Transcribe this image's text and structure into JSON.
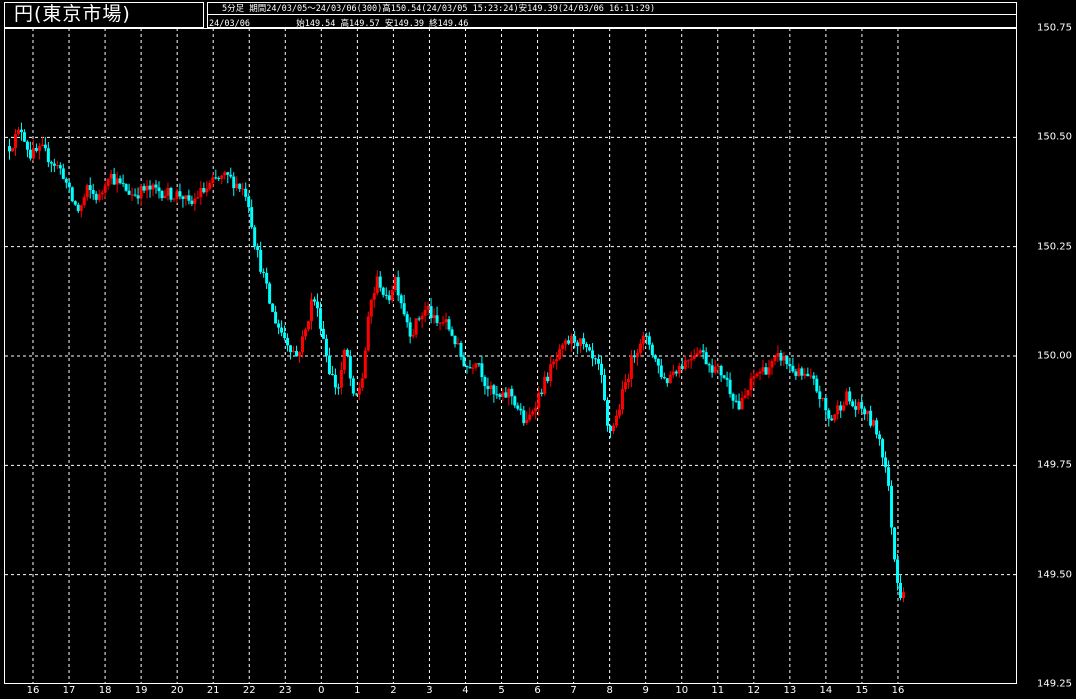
{
  "header": {
    "title": "円(東京市場)",
    "interval_label": "5分足",
    "range_text": "期間24/03/05～24/03/06(300)高150.54(24/03/05 15:23:24)安149.39(24/03/06 16:11:29)",
    "date_label": "24/03/06",
    "ohlc_text": "始149.54 高149.57 安149.39 終149.46"
  },
  "colors": {
    "up": "#ff0000",
    "down": "#00ffff",
    "grid": "#ffffff",
    "background": "#000000"
  },
  "chart_data": {
    "type": "candlestick",
    "title": "円(東京市場)",
    "ylim": [
      149.25,
      150.75
    ],
    "yticks": [
      "149.25",
      "149.50",
      "149.75",
      "150.00",
      "150.25",
      "150.50",
      "150.75"
    ],
    "xticks": [
      "16",
      "17",
      "18",
      "19",
      "20",
      "21",
      "22",
      "23",
      "0",
      "1",
      "2",
      "3",
      "4",
      "5",
      "6",
      "7",
      "8",
      "9",
      "10",
      "11",
      "12",
      "13",
      "14",
      "15",
      "16"
    ],
    "grid": true,
    "price_path": [
      [
        0,
        150.48
      ],
      [
        3,
        150.52
      ],
      [
        5,
        150.46
      ],
      [
        8,
        150.47
      ],
      [
        11,
        150.44
      ],
      [
        13,
        150.42
      ],
      [
        15,
        150.36
      ],
      [
        17,
        150.33
      ],
      [
        19,
        150.38
      ],
      [
        22,
        150.36
      ],
      [
        24,
        150.42
      ],
      [
        27,
        150.39
      ],
      [
        30,
        150.37
      ],
      [
        33,
        150.38
      ],
      [
        36,
        150.38
      ],
      [
        39,
        150.37
      ],
      [
        42,
        150.37
      ],
      [
        44,
        150.34
      ],
      [
        46,
        150.37
      ],
      [
        48,
        150.38
      ],
      [
        50,
        150.4
      ],
      [
        53,
        150.41
      ],
      [
        56,
        150.39
      ],
      [
        58,
        150.37
      ],
      [
        60,
        150.25
      ],
      [
        62,
        150.18
      ],
      [
        64,
        150.1
      ],
      [
        66,
        150.06
      ],
      [
        68,
        150.03
      ],
      [
        70,
        150.0
      ],
      [
        72,
        150.05
      ],
      [
        74,
        150.14
      ],
      [
        76,
        150.07
      ],
      [
        78,
        149.97
      ],
      [
        80,
        149.92
      ],
      [
        82,
        150.02
      ],
      [
        84,
        149.89
      ],
      [
        86,
        149.95
      ],
      [
        88,
        150.12
      ],
      [
        90,
        150.18
      ],
      [
        92,
        150.12
      ],
      [
        94,
        150.18
      ],
      [
        96,
        150.11
      ],
      [
        98,
        150.05
      ],
      [
        100,
        150.09
      ],
      [
        102,
        150.11
      ],
      [
        104,
        150.07
      ],
      [
        106,
        150.08
      ],
      [
        108,
        150.05
      ],
      [
        110,
        150.0
      ],
      [
        112,
        149.97
      ],
      [
        114,
        150.0
      ],
      [
        116,
        149.94
      ],
      [
        118,
        149.91
      ],
      [
        120,
        149.9
      ],
      [
        122,
        149.92
      ],
      [
        124,
        149.88
      ],
      [
        126,
        149.84
      ],
      [
        128,
        149.89
      ],
      [
        130,
        149.93
      ],
      [
        132,
        149.97
      ],
      [
        134,
        150.0
      ],
      [
        136,
        150.03
      ],
      [
        138,
        150.04
      ],
      [
        140,
        150.02
      ],
      [
        142,
        149.99
      ],
      [
        144,
        149.97
      ],
      [
        146,
        149.82
      ],
      [
        148,
        149.86
      ],
      [
        150,
        149.93
      ],
      [
        152,
        150.0
      ],
      [
        154,
        150.04
      ],
      [
        156,
        150.03
      ],
      [
        158,
        149.98
      ],
      [
        160,
        149.94
      ],
      [
        162,
        149.97
      ],
      [
        164,
        149.98
      ],
      [
        166,
        150.0
      ],
      [
        168,
        150.02
      ],
      [
        170,
        149.99
      ],
      [
        172,
        149.97
      ],
      [
        174,
        149.96
      ],
      [
        176,
        149.92
      ],
      [
        178,
        149.88
      ],
      [
        180,
        149.92
      ],
      [
        182,
        149.96
      ],
      [
        184,
        149.97
      ],
      [
        186,
        149.98
      ],
      [
        188,
        150.0
      ],
      [
        190,
        149.98
      ],
      [
        192,
        149.96
      ],
      [
        194,
        149.95
      ],
      [
        196,
        149.94
      ],
      [
        198,
        149.9
      ],
      [
        200,
        149.85
      ],
      [
        202,
        149.88
      ],
      [
        204,
        149.91
      ],
      [
        206,
        149.88
      ],
      [
        208,
        149.88
      ],
      [
        210,
        149.85
      ],
      [
        212,
        149.82
      ],
      [
        214,
        149.73
      ],
      [
        216,
        149.52
      ],
      [
        218,
        149.42
      ]
    ],
    "last_bar": {
      "open": 149.54,
      "high": 149.57,
      "low": 149.39,
      "close": 149.46
    },
    "period_high": 150.54,
    "period_low": 149.39
  }
}
